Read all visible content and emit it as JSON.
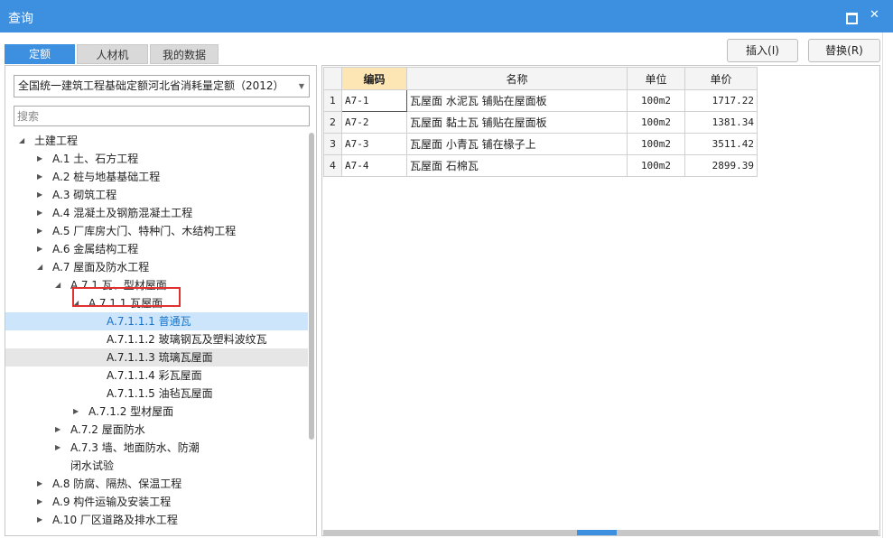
{
  "window": {
    "title": "查询",
    "maximize_icon": "maximize-icon",
    "close_label": "✕"
  },
  "tabs": [
    {
      "label": "定额",
      "active": true
    },
    {
      "label": "人材机",
      "active": false
    },
    {
      "label": "我的数据",
      "active": false
    }
  ],
  "buttons": {
    "insert": "插入(I)",
    "replace": "替换(R)"
  },
  "library_select": {
    "value": "全国统一建筑工程基础定额河北省消耗量定额（2012）"
  },
  "search": {
    "placeholder": "搜索"
  },
  "tree": [
    {
      "label": "土建工程",
      "expanded": true
    },
    {
      "label": "A.1 土、石方工程",
      "expanded": false
    },
    {
      "label": "A.2 桩与地基基础工程",
      "expanded": false
    },
    {
      "label": "A.3 砌筑工程",
      "expanded": false
    },
    {
      "label": "A.4 混凝土及钢筋混凝土工程",
      "expanded": false
    },
    {
      "label": "A.5 厂库房大门、特种门、木结构工程",
      "expanded": false
    },
    {
      "label": "A.6 金属结构工程",
      "expanded": false
    },
    {
      "label": "A.7 屋面及防水工程",
      "expanded": true
    },
    {
      "label": "A.7.1 瓦、型材屋面",
      "expanded": true
    },
    {
      "label": "A.7.1.1 瓦屋面",
      "expanded": true
    },
    {
      "label": "A.7.1.1.1 普通瓦",
      "selected": true
    },
    {
      "label": "A.7.1.1.2 玻璃钢瓦及塑料波纹瓦"
    },
    {
      "label": "A.7.1.1.3 琉璃瓦屋面",
      "hover": true
    },
    {
      "label": "A.7.1.1.4 彩瓦屋面"
    },
    {
      "label": "A.7.1.1.5 油毡瓦屋面"
    },
    {
      "label": "A.7.1.2 型材屋面",
      "expanded": false
    },
    {
      "label": "A.7.2 屋面防水",
      "expanded": false
    },
    {
      "label": "A.7.3 墙、地面防水、防潮",
      "expanded": false
    },
    {
      "label": "闭水试验"
    },
    {
      "label": "A.8 防腐、隔热、保温工程",
      "expanded": false
    },
    {
      "label": "A.9 构件运输及安装工程",
      "expanded": false
    },
    {
      "label": "A.10 厂区道路及排水工程",
      "expanded": false
    }
  ],
  "grid": {
    "headers": [
      "编码",
      "名称",
      "单位",
      "单价"
    ],
    "rows": [
      {
        "n": "1",
        "code": "A7-1",
        "name": "瓦屋面 水泥瓦 铺贴在屋面板",
        "unit": "100m2",
        "price": "1717.22"
      },
      {
        "n": "2",
        "code": "A7-2",
        "name": "瓦屋面 黏土瓦 铺贴在屋面板",
        "unit": "100m2",
        "price": "1381.34"
      },
      {
        "n": "3",
        "code": "A7-3",
        "name": "瓦屋面 小青瓦 铺在椽子上",
        "unit": "100m2",
        "price": "3511.42"
      },
      {
        "n": "4",
        "code": "A7-4",
        "name": "瓦屋面 石棉瓦",
        "unit": "100m2",
        "price": "2899.39"
      }
    ]
  },
  "colors": {
    "accent": "#3d8fe0",
    "selected_bg": "#cde5fb",
    "header_highlight": "#fde5b4",
    "annotation_red": "#e03030"
  }
}
